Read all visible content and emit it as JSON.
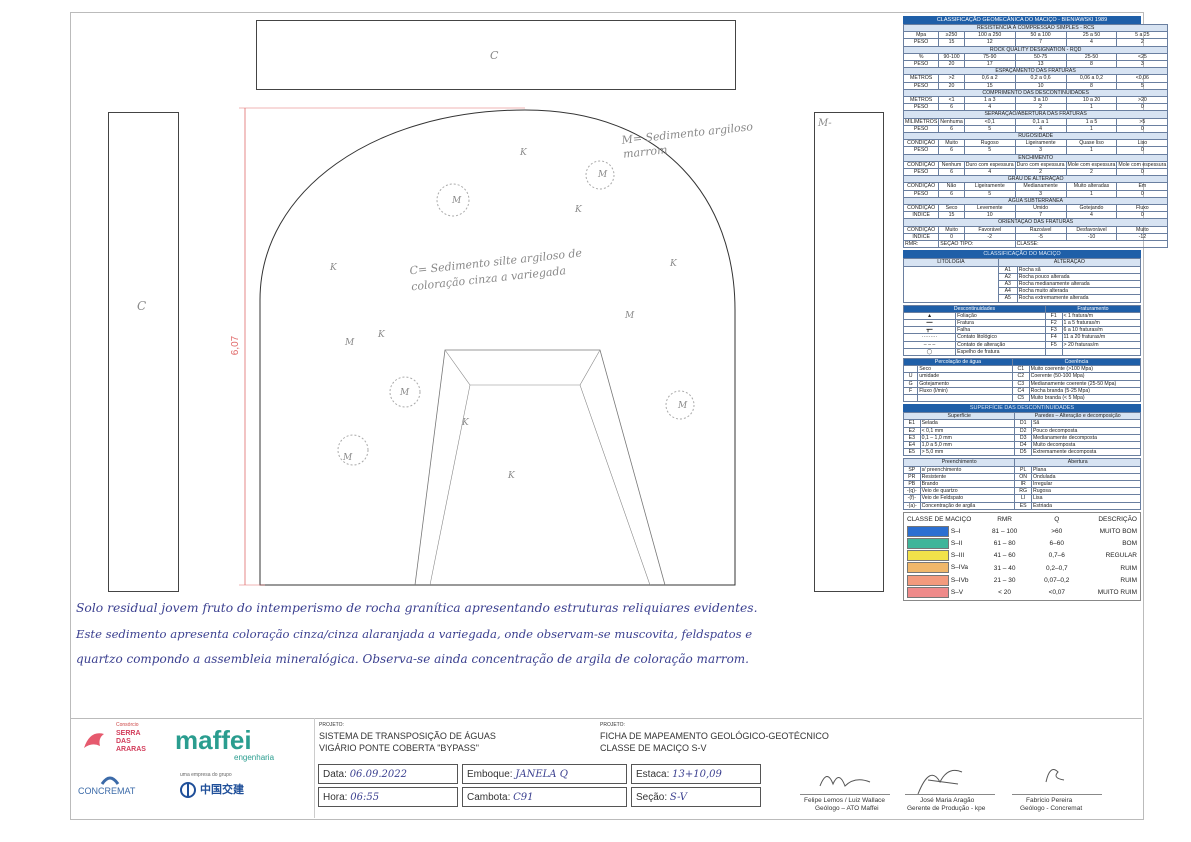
{
  "drawing": {
    "top_label": "C",
    "left_label": "C",
    "right_top_note": "M-",
    "height_dim": "6,07",
    "note_m": "M= Sedimento argiloso marrom",
    "note_c": "C= Sedimento silte argiloso de coloração cinza a variegada",
    "labels": [
      "M",
      "M",
      "M",
      "M",
      "M",
      "M",
      "M",
      "K",
      "K",
      "K",
      "K",
      "K",
      "K",
      "K"
    ]
  },
  "handwritten": {
    "line1": "Solo residual jovem fruto do intemperismo de rocha granítica apresentando estruturas reliquiares evidentes.",
    "line2": "Este sedimento apresenta coloração cinza/cinza alaranjada a variegada, onde observam-se muscovita, feldspatos e",
    "line3": "quartzo compondo a assembleia mineralógica. Observa-se ainda concentração de argila de coloração marrom."
  },
  "panel": {
    "title": "CLASSIFICAÇÃO GEOMECÂNICA DO MACIÇO - BIENIAWSKI 1989",
    "res_title": "RESISTÊNCIA À COMPRESSÃO SIMPLES - RCS",
    "res_head": [
      "Mpa",
      "≥250",
      "100 a 250",
      "50 a 100",
      "25 a 50",
      "5 a 25"
    ],
    "res_peso": [
      "PESO",
      "15",
      "12",
      "7",
      "4",
      "2"
    ],
    "rqd_title": "ROCK QUALITY DESIGNATION - RQD",
    "rqd_head": [
      "%",
      "90-100",
      "75-90",
      "50-75",
      "25-50",
      "<25"
    ],
    "rqd_peso": [
      "PESO",
      "20",
      "17",
      "13",
      "8",
      "3"
    ],
    "esp_title": "ESPAÇAMENTO DAS FRATURAS",
    "esp_head": [
      "METROS",
      ">2",
      "0,6 a 2",
      "0,2 a 0,6",
      "0,06 a 0,2",
      "<0,06"
    ],
    "esp_peso": [
      "PESO",
      "20",
      "15",
      "10",
      "8",
      "5"
    ],
    "comp_title": "COMPRIMENTO DAS DESCONTINUIDADES",
    "comp_head": [
      "METROS",
      "<1",
      "1 a 3",
      "3 a 10",
      "10 a 20",
      ">20"
    ],
    "comp_peso": [
      "PESO",
      "6",
      "4",
      "2",
      "1",
      "0"
    ],
    "sep_title": "SEPARAÇÃO/ABERTURA DAS FRATURAS",
    "sep_head": [
      "MILÍMETROS",
      "Nenhuma",
      "<0,1",
      "0,1 a 1",
      "1 a 5",
      ">5"
    ],
    "sep_peso": [
      "PESO",
      "6",
      "5",
      "4",
      "1",
      "0"
    ],
    "rug_title": "RUGOSIDADE",
    "rug_head": [
      "CONDIÇÃO",
      "Muito",
      "Rugoso",
      "Ligeiramente",
      "Quase liso",
      "Liso"
    ],
    "rug_peso": [
      "PESO",
      "6",
      "5",
      "3",
      "1",
      "0"
    ],
    "ench_title": "ENCHIMENTO",
    "ench_head": [
      "CONDIÇÃO",
      "Nenhum",
      "Duro com espessura",
      "Duro com espessura",
      "Mole com espessura",
      "Mole com espessura"
    ],
    "ench_peso": [
      "PESO",
      "6",
      "4",
      "2",
      "2",
      "0"
    ],
    "alt_title": "GRAU DE ALTERAÇÃO",
    "alt_head": [
      "CONDIÇÃO",
      "Não",
      "Ligeiramente",
      "Medianamente",
      "Muito alteradas",
      "Em"
    ],
    "alt_peso": [
      "PESO",
      "6",
      "5",
      "3",
      "1",
      "0"
    ],
    "agua_title": "ÁGUA SUBTERRÂNEA",
    "agua_head": [
      "CONDIÇÃO",
      "Seco",
      "Levemente",
      "Úmido",
      "Gotejando",
      "Fluxo"
    ],
    "agua_peso": [
      "ÍNDICE",
      "15",
      "10",
      "7",
      "4",
      "0"
    ],
    "ori_title": "ORIENTAÇÃO DAS FRATURAS",
    "ori_head": [
      "CONDIÇÃO",
      "Muito",
      "Favorável",
      "Razoável",
      "Desfavorável",
      "Muito"
    ],
    "ori_peso": [
      "ÍNDICE",
      "0",
      "-2",
      "-5",
      "-10",
      "-12"
    ],
    "rmr_row": [
      "RMR:",
      "SEÇÃO TIPO:",
      "CLASSE:"
    ],
    "lit_title": "CLASSIFICAÇÃO DO MACIÇO",
    "lit_col1": "LITOLOGIA",
    "lit_col2": "ALTERAÇÃO",
    "alteracao": [
      [
        "A1",
        "Rocha sã"
      ],
      [
        "A2",
        "Rocha pouco alterada"
      ],
      [
        "A3",
        "Rocha medianamente alterada"
      ],
      [
        "A4",
        "Rocha muito alterada"
      ],
      [
        "A5",
        "Rocha extremamente alterada"
      ]
    ],
    "desc_title": "Descontinuidades",
    "frat_title": "Fraturamento",
    "descont": [
      "Foliação",
      "Fratura",
      "Falha",
      "Contato litológico",
      "Contato de alteração",
      "Espelho de fratura"
    ],
    "frat": [
      [
        "F1",
        "< 1 fratura/m"
      ],
      [
        "F2",
        "1 a 5 fraturas/m"
      ],
      [
        "F3",
        "6 a 10 fraturas/m"
      ],
      [
        "F4",
        "11 a 20 fraturas/m"
      ],
      [
        "F5",
        "> 20 fraturas/m"
      ]
    ],
    "perc_title": "Percolação de água",
    "coer_title": "Coerência",
    "perc": [
      [
        "",
        "Seco"
      ],
      [
        "U",
        "umidade"
      ],
      [
        "G",
        "Gotejamento"
      ],
      [
        "F",
        "Fluxo (l/min)"
      ]
    ],
    "coer": [
      [
        "C1",
        "Muito coerente (>100 Mpa)"
      ],
      [
        "C2",
        "Coerente (50-100 Mpa)"
      ],
      [
        "C3",
        "Medianamente coerente (25-50 Mpa)"
      ],
      [
        "C4",
        "Rocha branda (5-25 Mpa)"
      ],
      [
        "C5",
        "Muito branda (< 5 Mpa)"
      ]
    ],
    "sup_title": "SUPERFÍCIE DAS DESCONTINUIDADES",
    "sup_col1": "Superfície",
    "sup_col2": "Paredes – Alteração e decomposição",
    "sup": [
      [
        "E1",
        "Selada"
      ],
      [
        "E2",
        "< 0,1 mm"
      ],
      [
        "E3",
        "0,1 – 1,0 mm"
      ],
      [
        "E4",
        "1,0 a 5,0 mm"
      ],
      [
        "E5",
        "> 5,0 mm"
      ]
    ],
    "par": [
      [
        "D1",
        "Sã"
      ],
      [
        "D2",
        "Pouco decomposta"
      ],
      [
        "D3",
        "Medianamente decomposta"
      ],
      [
        "D4",
        "Muito decomposta"
      ],
      [
        "D5",
        "Extremamente decomposta"
      ]
    ],
    "pre_title": "Preenchimento",
    "abe_title": "Abertura",
    "pre": [
      [
        "SP",
        "s/ preenchimento"
      ],
      [
        "PR",
        "Resistente"
      ],
      [
        "PB",
        "Brando"
      ],
      [
        "-(q)-",
        "Veio de quartzo"
      ],
      [
        "-(f)-",
        "Veio de Feldspato"
      ],
      [
        "-(a)-",
        "Concentração de argila"
      ]
    ],
    "abe": [
      [
        "PL",
        "Plana"
      ],
      [
        "ON",
        "Ondulada"
      ],
      [
        "IR",
        "Irregular"
      ],
      [
        "RG",
        "Rugosa"
      ],
      [
        "LI",
        "Lisa"
      ],
      [
        "ES",
        "Estriada"
      ]
    ],
    "class_head": [
      "CLASSE DE MACIÇO",
      "RMR",
      "Q",
      "DESCRIÇÃO"
    ],
    "classes": [
      {
        "cls": "S–I",
        "rmr": "81 – 100",
        "q": ">60",
        "desc": "MUITO BOM",
        "color": "#2b6fd1"
      },
      {
        "cls": "S–II",
        "rmr": "61 – 80",
        "q": "6–60",
        "desc": "BOM",
        "color": "#3fb59a"
      },
      {
        "cls": "S–III",
        "rmr": "41 – 60",
        "q": "0,7–6",
        "desc": "REGULAR",
        "color": "#f2e24a"
      },
      {
        "cls": "S–IVa",
        "rmr": "31 – 40",
        "q": "0,2–0,7",
        "desc": "RUIM",
        "color": "#f0b76a"
      },
      {
        "cls": "S–IVb",
        "rmr": "21 – 30",
        "q": "0,07–0,2",
        "desc": "RUIM",
        "color": "#f39a7d"
      },
      {
        "cls": "S–V",
        "rmr": "< 20",
        "q": "<0,07",
        "desc": "MUITO RUIM",
        "color": "#ee8a8a"
      }
    ]
  },
  "footer": {
    "logo_consorcio": "Consórcio",
    "logo_serra": "SERRA DAS ARARAS",
    "logo_maffei": "maffei",
    "logo_engenharia": "engenharia",
    "logo_concremat": "CONCREMAT",
    "logo_cccc": "中国交建",
    "logo_tagline": "uma empresa do grupo",
    "projeto_label": "PROJETO:",
    "projeto1": "SISTEMA DE TRANSPOSIÇÃO DE ÁGUAS",
    "projeto2": "VIGÁRIO PONTE COBERTA \"BYPASS\"",
    "projeto_label2": "PROJETO:",
    "ficha1": "FICHA DE MAPEAMENTO GEOLÓGICO-GEOTÉCNICO",
    "ficha2": "CLASSE DE MACIÇO S-V",
    "data_label": "Data:",
    "data_val": "06.09.2022",
    "hora_label": "Hora:",
    "hora_val": "06:55",
    "emboque_label": "Emboque:",
    "emboque_val": "JANELA Q",
    "cambota_label": "Cambota:",
    "cambota_val": "C91",
    "estaca_label": "Estaca:",
    "estaca_val": "13+10,09",
    "secao_label": "Seção:",
    "secao_val": "S-V",
    "sig1_name": "Felipe Lemos / Luiz Wallace",
    "sig1_role": "Geólogo – ATO Maffei",
    "sig2_name": "José Maria Aragão",
    "sig2_role": "Gerente de Produção - kpe",
    "sig3_name": "Fabrício Pereira",
    "sig3_role": "Geólogo - Concremat"
  }
}
